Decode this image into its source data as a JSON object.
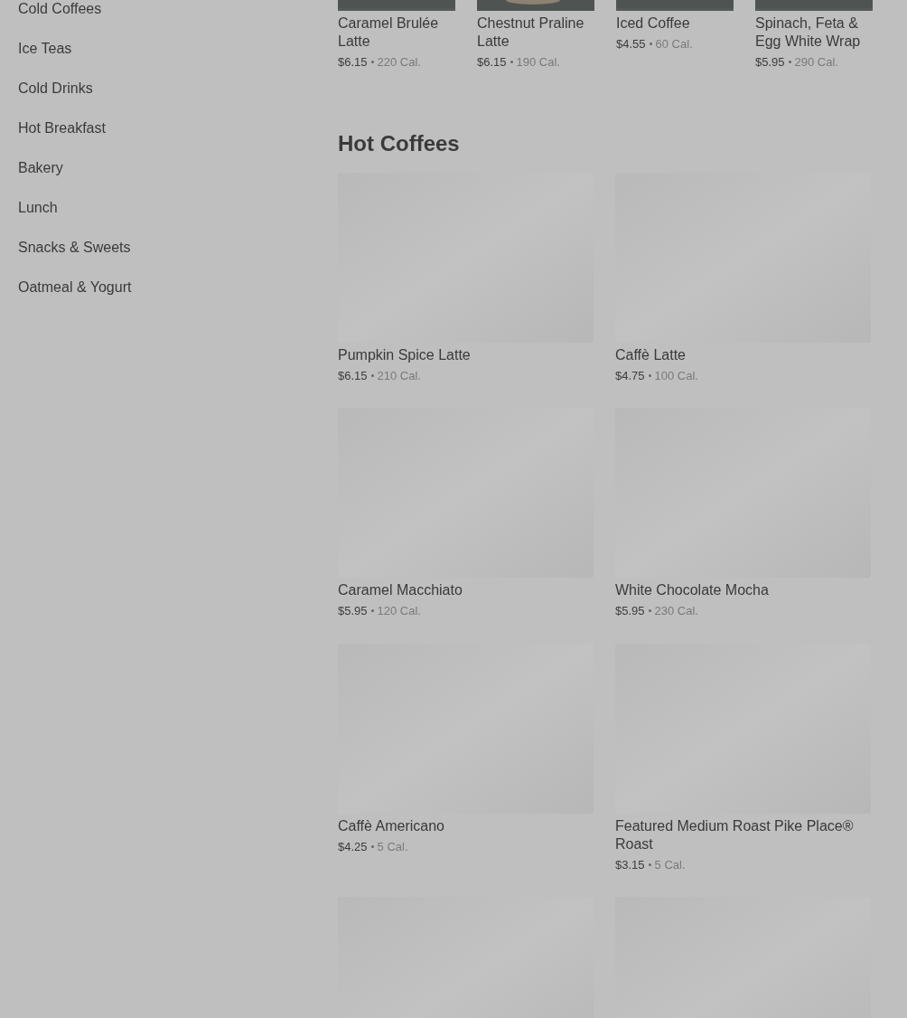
{
  "sidebar": {
    "items": [
      {
        "label": "Cold Coffees"
      },
      {
        "label": "Ice Teas"
      },
      {
        "label": "Cold Drinks"
      },
      {
        "label": "Hot Breakfast"
      },
      {
        "label": "Bakery"
      },
      {
        "label": "Lunch"
      },
      {
        "label": "Snacks & Sweets"
      },
      {
        "label": "Oatmeal & Yogurt"
      }
    ]
  },
  "featured": {
    "items": [
      {
        "name": "Caramel Brulée Latte",
        "price": "$6.15",
        "calories": "220 Cal."
      },
      {
        "name": "Chestnut Praline Latte",
        "price": "$6.15",
        "calories": "190 Cal."
      },
      {
        "name": "Iced Coffee",
        "price": "$4.55",
        "calories": "60 Cal."
      },
      {
        "name": "Spinach, Feta & Egg White Wrap",
        "price": "$5.95",
        "calories": "290 Cal."
      }
    ]
  },
  "section": {
    "title": "Hot Coffees",
    "items": [
      {
        "kind": "product",
        "name": "Pumpkin Spice Latte",
        "price": "$6.15",
        "calories": "210 Cal."
      },
      {
        "kind": "product",
        "name": "Caffè Latte",
        "price": "$4.75",
        "calories": "100 Cal."
      },
      {
        "kind": "product",
        "name": "Caramel Macchiato",
        "price": "$5.95",
        "calories": "120 Cal."
      },
      {
        "kind": "product",
        "name": "White Chocolate Mocha",
        "price": "$5.95",
        "calories": "230 Cal."
      },
      {
        "kind": "product",
        "name": "Caffè Americano",
        "price": "$4.25",
        "calories": "5 Cal."
      },
      {
        "kind": "product",
        "name": "Featured Medium Roast Pike Place® Roast",
        "price": "$3.15",
        "calories": "5 Cal."
      },
      {
        "kind": "placeholder"
      },
      {
        "kind": "placeholder"
      }
    ]
  }
}
